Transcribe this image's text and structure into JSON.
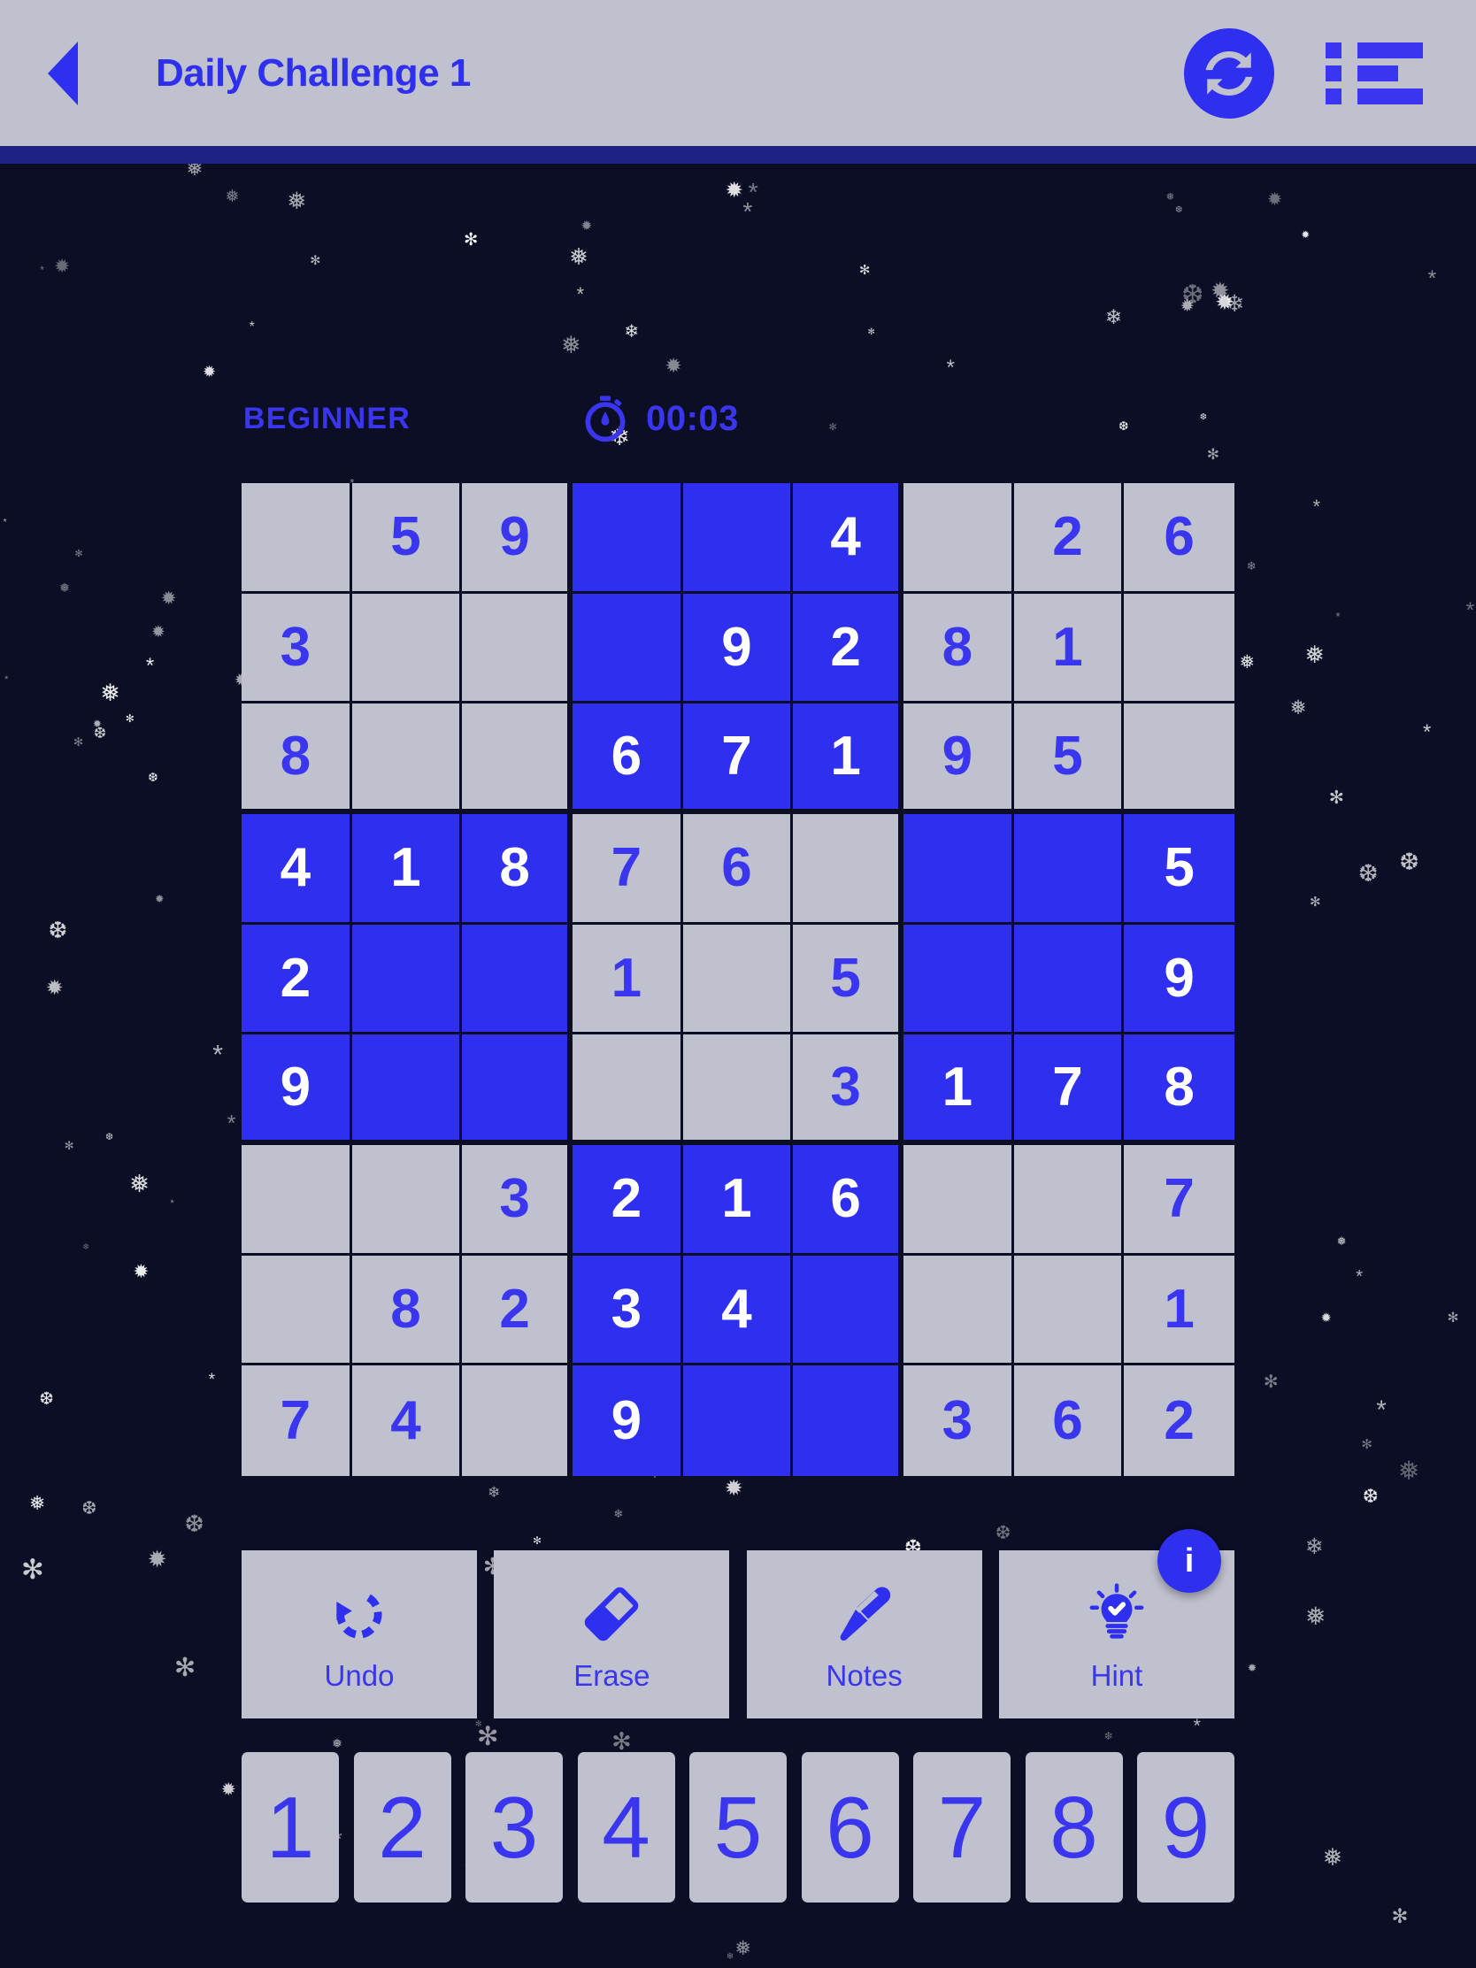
{
  "header": {
    "back_icon": "back-arrow-icon",
    "title": "Daily Challenge 1",
    "refresh_icon": "refresh-icon",
    "menu_icon": "list-menu-icon"
  },
  "meta": {
    "difficulty": "BEGINNER",
    "timer_icon": "stopwatch-icon",
    "timer": "00:03"
  },
  "colors": {
    "background": "#0b0e24",
    "header_bg": "#bfc1cf",
    "strip": "#1f2183",
    "accent": "#3a35ee",
    "highlight": "#2f2ff0",
    "cell_bg": "#bfc1cf",
    "highlight_text": "#ffffff"
  },
  "board": {
    "rows": [
      [
        "",
        "5",
        "9",
        "",
        "",
        "4",
        "",
        "2",
        "6"
      ],
      [
        "3",
        "",
        "",
        "",
        "9",
        "2",
        "8",
        "1",
        ""
      ],
      [
        "8",
        "",
        "",
        "6",
        "7",
        "1",
        "9",
        "5",
        ""
      ],
      [
        "4",
        "1",
        "8",
        "7",
        "6",
        "",
        "",
        "",
        "5"
      ],
      [
        "2",
        "",
        "",
        "1",
        "",
        "5",
        "",
        "",
        "9"
      ],
      [
        "9",
        "",
        "",
        "",
        "",
        "3",
        "1",
        "7",
        "8"
      ],
      [
        "",
        "",
        "3",
        "2",
        "1",
        "6",
        "",
        "",
        "7"
      ],
      [
        "",
        "8",
        "2",
        "3",
        "4",
        "",
        "",
        "",
        "1"
      ],
      [
        "7",
        "4",
        "",
        "9",
        "",
        "",
        "3",
        "6",
        "2"
      ]
    ],
    "highlighted": [
      [
        false,
        false,
        false,
        true,
        true,
        true,
        false,
        false,
        false
      ],
      [
        false,
        false,
        false,
        true,
        true,
        true,
        false,
        false,
        false
      ],
      [
        false,
        false,
        false,
        true,
        true,
        true,
        false,
        false,
        false
      ],
      [
        true,
        true,
        true,
        false,
        false,
        false,
        true,
        true,
        true
      ],
      [
        true,
        true,
        true,
        false,
        false,
        false,
        true,
        true,
        true
      ],
      [
        true,
        true,
        true,
        false,
        false,
        false,
        true,
        true,
        true
      ],
      [
        false,
        false,
        false,
        true,
        true,
        true,
        false,
        false,
        false
      ],
      [
        false,
        false,
        false,
        true,
        true,
        true,
        false,
        false,
        false
      ],
      [
        false,
        false,
        false,
        true,
        true,
        true,
        false,
        false,
        false
      ]
    ]
  },
  "actions": [
    {
      "label": "Undo",
      "icon": "undo-icon"
    },
    {
      "label": "Erase",
      "icon": "eraser-icon"
    },
    {
      "label": "Notes",
      "icon": "pen-icon"
    },
    {
      "label": "Hint",
      "icon": "lightbulb-icon"
    }
  ],
  "info_badge": {
    "label": "i",
    "icon": "info-icon"
  },
  "number_pad": [
    "1",
    "2",
    "3",
    "4",
    "5",
    "6",
    "7",
    "8",
    "9"
  ]
}
